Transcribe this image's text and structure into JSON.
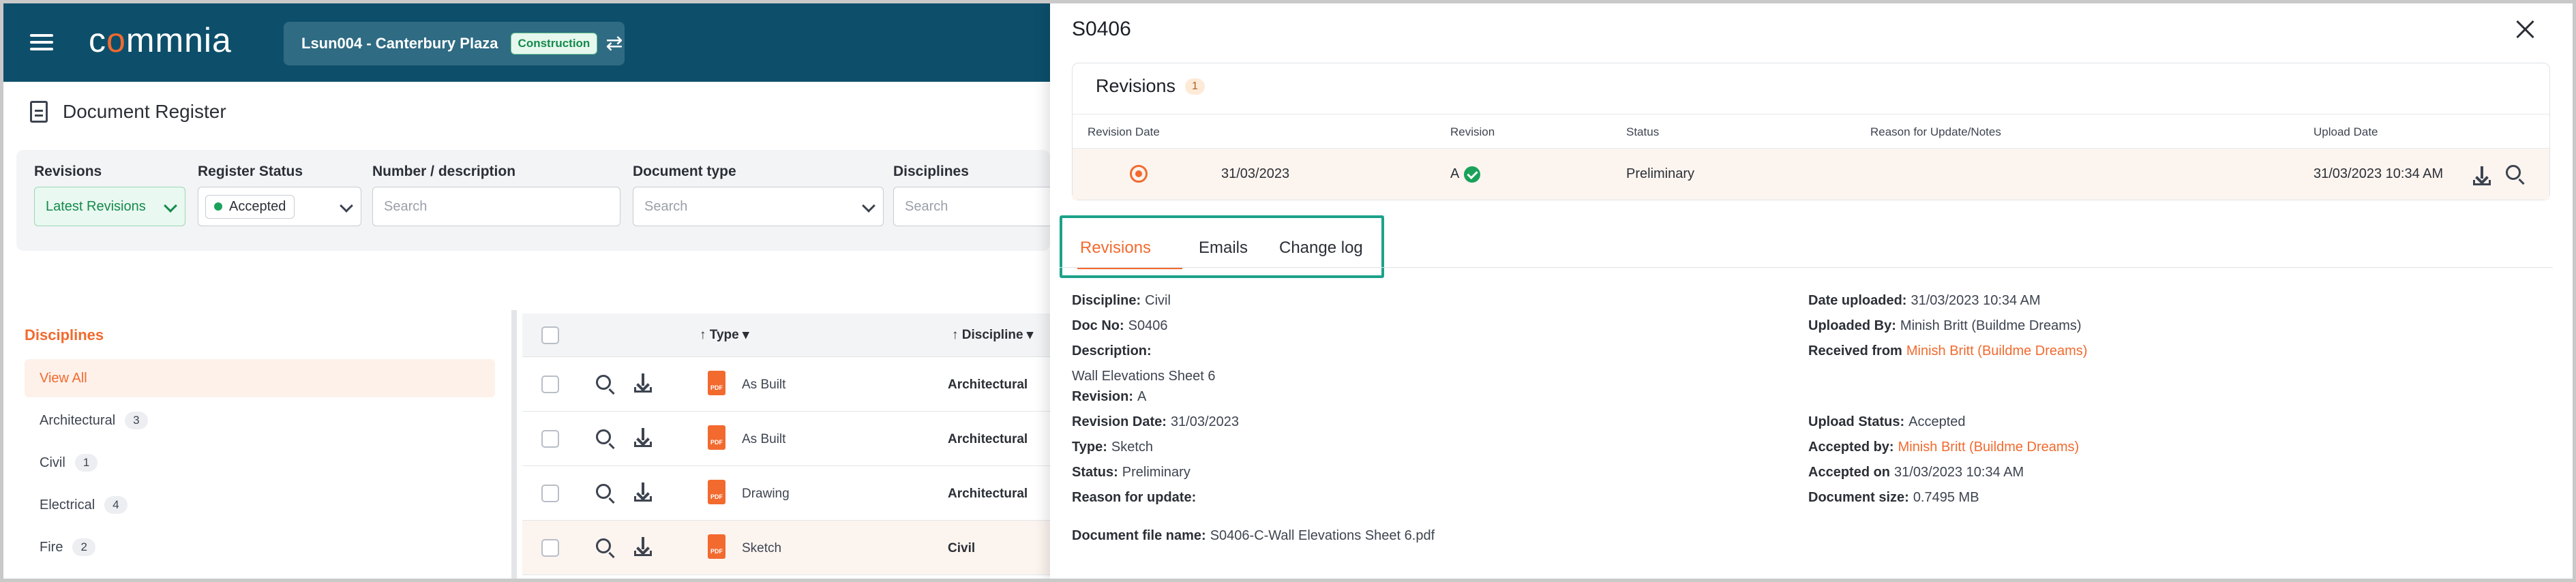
{
  "header": {
    "logo": {
      "pre": "c",
      "mid": "o",
      "post": "mmnia"
    },
    "project_name": "Lsun004 - Canterbury Plaza",
    "project_badge": "Construction"
  },
  "page": {
    "title": "Document Register"
  },
  "filters": {
    "revisions": {
      "label": "Revisions",
      "value": "Latest Revisions"
    },
    "register_status": {
      "label": "Register Status",
      "value": "Accepted"
    },
    "number_description": {
      "label": "Number / description",
      "placeholder": "Search"
    },
    "document_type": {
      "label": "Document type",
      "placeholder": "Search"
    },
    "disciplines": {
      "label": "Disciplines",
      "placeholder": "Search"
    }
  },
  "disciplines": {
    "title": "Disciplines",
    "items": [
      {
        "label": "View All",
        "count": ""
      },
      {
        "label": "Architectural",
        "count": "3"
      },
      {
        "label": "Civil",
        "count": "1"
      },
      {
        "label": "Electrical",
        "count": "4"
      },
      {
        "label": "Fire",
        "count": "2"
      }
    ]
  },
  "table": {
    "headers": {
      "type": "Type",
      "discipline": "Discipline"
    },
    "rows": [
      {
        "type": "As Built",
        "discipline": "Architectural"
      },
      {
        "type": "As Built",
        "discipline": "Architectural"
      },
      {
        "type": "Drawing",
        "discipline": "Architectural"
      },
      {
        "type": "Sketch",
        "discipline": "Civil"
      }
    ],
    "pdf_label": "PDF"
  },
  "detail": {
    "title": "S0406",
    "revisions_card": {
      "heading": "Revisions",
      "count": "1",
      "headers": {
        "date": "Revision Date",
        "revision": "Revision",
        "status": "Status",
        "reason": "Reason for Update/Notes",
        "upload": "Upload Date"
      },
      "row": {
        "date": "31/03/2023",
        "revision": "A",
        "status": "Preliminary",
        "reason": "",
        "upload": "31/03/2023 10:34 AM"
      }
    },
    "tabs": [
      "Revisions",
      "Emails",
      "Change log"
    ],
    "fields": {
      "discipline": {
        "k": "Discipline:",
        "v": "Civil"
      },
      "doc_no": {
        "k": "Doc No:",
        "v": "S0406"
      },
      "description": {
        "k": "Description:",
        "v": "Wall Elevations Sheet 6"
      },
      "revision": {
        "k": "Revision:",
        "v": "A"
      },
      "revision_date": {
        "k": "Revision Date:",
        "v": "31/03/2023"
      },
      "type": {
        "k": "Type:",
        "v": "Sketch"
      },
      "status": {
        "k": "Status:",
        "v": "Preliminary"
      },
      "reason": {
        "k": "Reason for update:",
        "v": ""
      },
      "file_name": {
        "k": "Document file name:",
        "v": "S0406-C-Wall Elevations Sheet 6.pdf"
      },
      "date_uploaded": {
        "k": "Date uploaded:",
        "v": "31/03/2023 10:34 AM"
      },
      "uploaded_by": {
        "k": "Uploaded By:",
        "v": "Minish Britt (Buildme Dreams)"
      },
      "received_from": {
        "k": "Received from",
        "v": "Minish Britt (Buildme Dreams)"
      },
      "upload_status": {
        "k": "Upload Status:",
        "v": "Accepted"
      },
      "accepted_by": {
        "k": "Accepted by:",
        "v": "Minish Britt (Buildme Dreams)"
      },
      "accepted_on": {
        "k": "Accepted on",
        "v": "31/03/2023 10:34 AM"
      },
      "document_size": {
        "k": "Document size:",
        "v": "0.7495 MB"
      }
    }
  },
  "colors": {
    "header": "#0d4f6b",
    "accent": "#f26a2e",
    "success": "#1aa25a",
    "highlight_box": "#1ca28a"
  }
}
